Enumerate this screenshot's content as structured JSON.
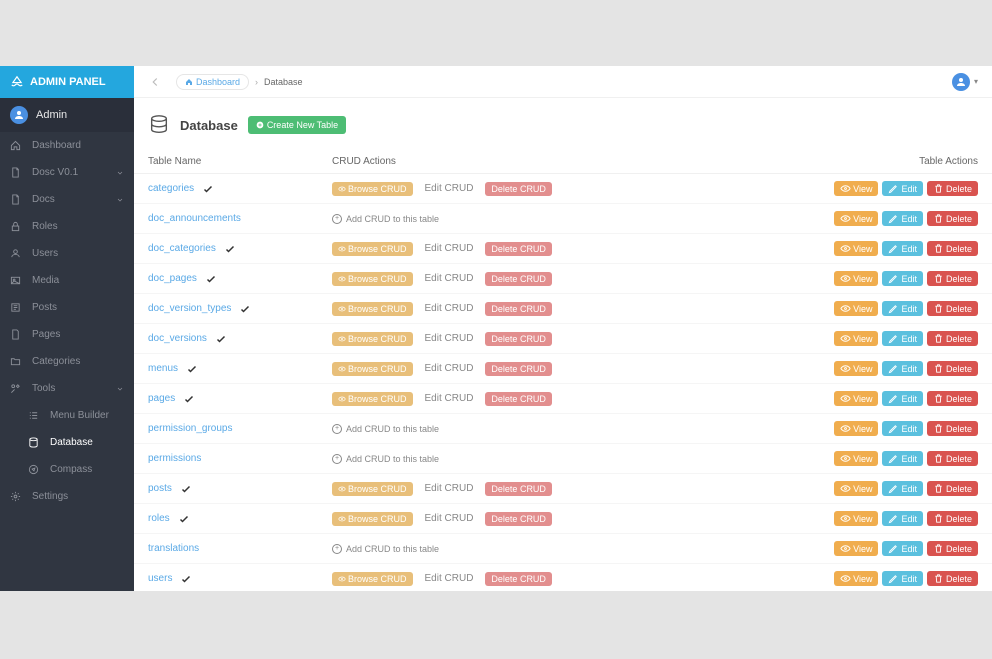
{
  "brand": "ADMIN PANEL",
  "user": "Admin",
  "sidebar": {
    "items": [
      {
        "label": "Dashboard",
        "icon": "home"
      },
      {
        "label": "Dosc V0.1",
        "icon": "doc",
        "caret": true
      },
      {
        "label": "Docs",
        "icon": "doc",
        "caret": true
      },
      {
        "label": "Roles",
        "icon": "lock"
      },
      {
        "label": "Users",
        "icon": "user"
      },
      {
        "label": "Media",
        "icon": "image"
      },
      {
        "label": "Posts",
        "icon": "news"
      },
      {
        "label": "Pages",
        "icon": "file"
      },
      {
        "label": "Categories",
        "icon": "folder"
      },
      {
        "label": "Tools",
        "icon": "tools",
        "caret": true,
        "open": true
      },
      {
        "label": "Menu Builder",
        "icon": "list",
        "sub": true
      },
      {
        "label": "Database",
        "icon": "db",
        "sub": true,
        "active": true
      },
      {
        "label": "Compass",
        "icon": "compass",
        "sub": true
      },
      {
        "label": "Settings",
        "icon": "gear"
      }
    ]
  },
  "breadcrumb": {
    "dashboard": "Dashboard",
    "current": "Database"
  },
  "page": {
    "title": "Database",
    "create": "Create New Table"
  },
  "table": {
    "headers": {
      "name": "Table Name",
      "crud": "CRUD Actions",
      "actions": "Table Actions"
    },
    "buttons": {
      "browse": "Browse CRUD",
      "editCrud": "Edit CRUD",
      "deleteCrud": "Delete CRUD",
      "addCrud": "Add CRUD to this table",
      "view": "View",
      "edit": "Edit",
      "del": "Delete"
    },
    "rows": [
      {
        "name": "categories",
        "hasCrud": true,
        "check": true
      },
      {
        "name": "doc_announcements",
        "hasCrud": false
      },
      {
        "name": "doc_categories",
        "hasCrud": true,
        "check": true
      },
      {
        "name": "doc_pages",
        "hasCrud": true,
        "check": true
      },
      {
        "name": "doc_version_types",
        "hasCrud": true,
        "check": true
      },
      {
        "name": "doc_versions",
        "hasCrud": true,
        "check": true
      },
      {
        "name": "menus",
        "hasCrud": true,
        "check": true
      },
      {
        "name": "pages",
        "hasCrud": true,
        "check": true
      },
      {
        "name": "permission_groups",
        "hasCrud": false
      },
      {
        "name": "permissions",
        "hasCrud": false
      },
      {
        "name": "posts",
        "hasCrud": true,
        "check": true
      },
      {
        "name": "roles",
        "hasCrud": true,
        "check": true
      },
      {
        "name": "translations",
        "hasCrud": false
      },
      {
        "name": "users",
        "hasCrud": true,
        "check": true
      }
    ]
  }
}
